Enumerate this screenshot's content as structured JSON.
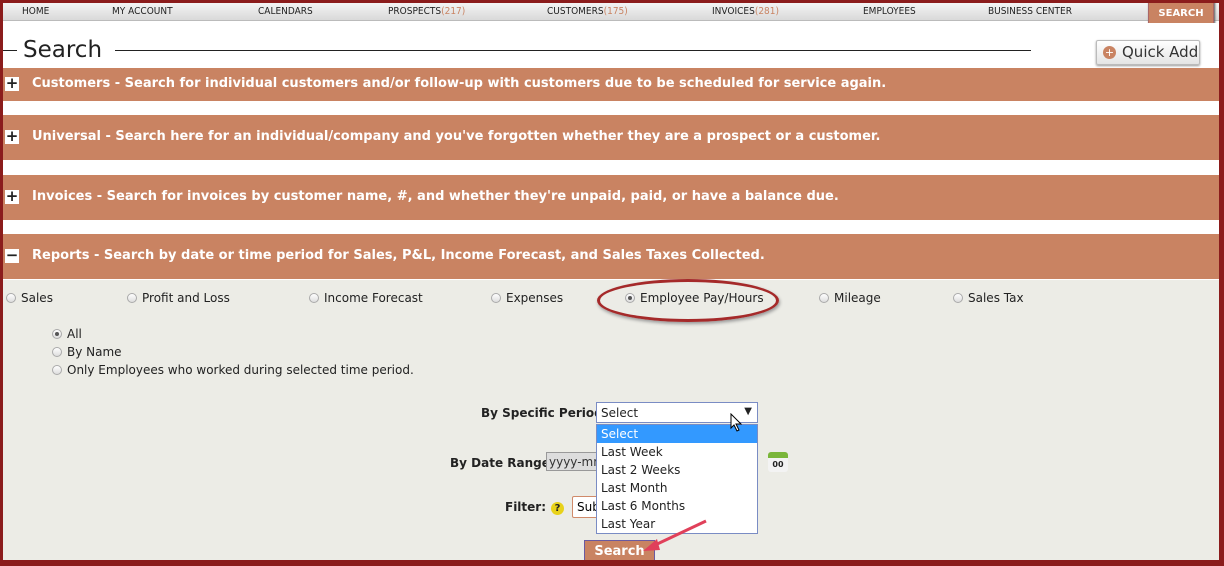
{
  "nav": {
    "items": [
      {
        "label": "HOME"
      },
      {
        "label": "MY ACCOUNT"
      },
      {
        "label": "CALENDARS"
      },
      {
        "label": "PROSPECTS",
        "count": "(217)"
      },
      {
        "label": "CUSTOMERS",
        "count": "(175)"
      },
      {
        "label": "INVOICES",
        "count": "(281)"
      },
      {
        "label": "EMPLOYEES"
      },
      {
        "label": "BUSINESS CENTER"
      }
    ],
    "search": "SEARCH"
  },
  "header": {
    "title": "Search",
    "quick_add": "Quick Add"
  },
  "panels": [
    {
      "sign": "+",
      "text": "Customers - Search for individual customers and/or follow-up with customers due to be scheduled for service again."
    },
    {
      "sign": "+",
      "text": "Universal - Search here for an individual/company and you've forgotten whether they are a prospect or a customer."
    },
    {
      "sign": "+",
      "text": "Invoices - Search for invoices by customer name, #, and whether they're unpaid, paid, or have a balance due."
    },
    {
      "sign": "−",
      "text": "Reports - Search by date or time period for Sales, P&L, Income Forecast, and Sales Taxes Collected."
    }
  ],
  "report_types": [
    "Sales",
    "Profit and Loss",
    "Income Forecast",
    "Expenses",
    "Employee Pay/Hours",
    "Mileage",
    "Sales Tax"
  ],
  "employee_options": [
    "All",
    "By Name",
    "Only Employees who worked during selected time period."
  ],
  "form": {
    "period_label": "By Specific Period:",
    "period_value": "Select",
    "period_options": [
      "Select",
      "Last Week",
      "Last 2 Weeks",
      "Last Month",
      "Last 6 Months",
      "Last Year"
    ],
    "date_label": "By Date Range:",
    "date_placeholder": "yyyy-mm",
    "calendar": "00",
    "filter_label": "Filter:",
    "help": "?",
    "filter_value": "Sub",
    "search_button": "Search"
  },
  "colors": {
    "accent": "#c98362",
    "frame": "#8b1c1c"
  }
}
